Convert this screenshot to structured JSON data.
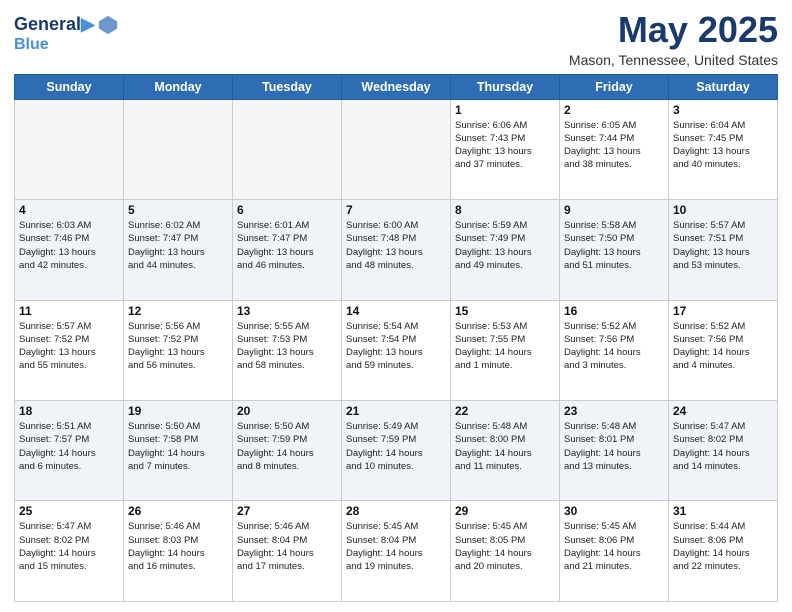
{
  "header": {
    "logo_line1": "General",
    "logo_line2": "Blue",
    "month": "May 2025",
    "location": "Mason, Tennessee, United States"
  },
  "days_of_week": [
    "Sunday",
    "Monday",
    "Tuesday",
    "Wednesday",
    "Thursday",
    "Friday",
    "Saturday"
  ],
  "weeks": [
    [
      {
        "day": "",
        "info": ""
      },
      {
        "day": "",
        "info": ""
      },
      {
        "day": "",
        "info": ""
      },
      {
        "day": "",
        "info": ""
      },
      {
        "day": "1",
        "info": "Sunrise: 6:06 AM\nSunset: 7:43 PM\nDaylight: 13 hours\nand 37 minutes."
      },
      {
        "day": "2",
        "info": "Sunrise: 6:05 AM\nSunset: 7:44 PM\nDaylight: 13 hours\nand 38 minutes."
      },
      {
        "day": "3",
        "info": "Sunrise: 6:04 AM\nSunset: 7:45 PM\nDaylight: 13 hours\nand 40 minutes."
      }
    ],
    [
      {
        "day": "4",
        "info": "Sunrise: 6:03 AM\nSunset: 7:46 PM\nDaylight: 13 hours\nand 42 minutes."
      },
      {
        "day": "5",
        "info": "Sunrise: 6:02 AM\nSunset: 7:47 PM\nDaylight: 13 hours\nand 44 minutes."
      },
      {
        "day": "6",
        "info": "Sunrise: 6:01 AM\nSunset: 7:47 PM\nDaylight: 13 hours\nand 46 minutes."
      },
      {
        "day": "7",
        "info": "Sunrise: 6:00 AM\nSunset: 7:48 PM\nDaylight: 13 hours\nand 48 minutes."
      },
      {
        "day": "8",
        "info": "Sunrise: 5:59 AM\nSunset: 7:49 PM\nDaylight: 13 hours\nand 49 minutes."
      },
      {
        "day": "9",
        "info": "Sunrise: 5:58 AM\nSunset: 7:50 PM\nDaylight: 13 hours\nand 51 minutes."
      },
      {
        "day": "10",
        "info": "Sunrise: 5:57 AM\nSunset: 7:51 PM\nDaylight: 13 hours\nand 53 minutes."
      }
    ],
    [
      {
        "day": "11",
        "info": "Sunrise: 5:57 AM\nSunset: 7:52 PM\nDaylight: 13 hours\nand 55 minutes."
      },
      {
        "day": "12",
        "info": "Sunrise: 5:56 AM\nSunset: 7:52 PM\nDaylight: 13 hours\nand 56 minutes."
      },
      {
        "day": "13",
        "info": "Sunrise: 5:55 AM\nSunset: 7:53 PM\nDaylight: 13 hours\nand 58 minutes."
      },
      {
        "day": "14",
        "info": "Sunrise: 5:54 AM\nSunset: 7:54 PM\nDaylight: 13 hours\nand 59 minutes."
      },
      {
        "day": "15",
        "info": "Sunrise: 5:53 AM\nSunset: 7:55 PM\nDaylight: 14 hours\nand 1 minute."
      },
      {
        "day": "16",
        "info": "Sunrise: 5:52 AM\nSunset: 7:56 PM\nDaylight: 14 hours\nand 3 minutes."
      },
      {
        "day": "17",
        "info": "Sunrise: 5:52 AM\nSunset: 7:56 PM\nDaylight: 14 hours\nand 4 minutes."
      }
    ],
    [
      {
        "day": "18",
        "info": "Sunrise: 5:51 AM\nSunset: 7:57 PM\nDaylight: 14 hours\nand 6 minutes."
      },
      {
        "day": "19",
        "info": "Sunrise: 5:50 AM\nSunset: 7:58 PM\nDaylight: 14 hours\nand 7 minutes."
      },
      {
        "day": "20",
        "info": "Sunrise: 5:50 AM\nSunset: 7:59 PM\nDaylight: 14 hours\nand 8 minutes."
      },
      {
        "day": "21",
        "info": "Sunrise: 5:49 AM\nSunset: 7:59 PM\nDaylight: 14 hours\nand 10 minutes."
      },
      {
        "day": "22",
        "info": "Sunrise: 5:48 AM\nSunset: 8:00 PM\nDaylight: 14 hours\nand 11 minutes."
      },
      {
        "day": "23",
        "info": "Sunrise: 5:48 AM\nSunset: 8:01 PM\nDaylight: 14 hours\nand 13 minutes."
      },
      {
        "day": "24",
        "info": "Sunrise: 5:47 AM\nSunset: 8:02 PM\nDaylight: 14 hours\nand 14 minutes."
      }
    ],
    [
      {
        "day": "25",
        "info": "Sunrise: 5:47 AM\nSunset: 8:02 PM\nDaylight: 14 hours\nand 15 minutes."
      },
      {
        "day": "26",
        "info": "Sunrise: 5:46 AM\nSunset: 8:03 PM\nDaylight: 14 hours\nand 16 minutes."
      },
      {
        "day": "27",
        "info": "Sunrise: 5:46 AM\nSunset: 8:04 PM\nDaylight: 14 hours\nand 17 minutes."
      },
      {
        "day": "28",
        "info": "Sunrise: 5:45 AM\nSunset: 8:04 PM\nDaylight: 14 hours\nand 19 minutes."
      },
      {
        "day": "29",
        "info": "Sunrise: 5:45 AM\nSunset: 8:05 PM\nDaylight: 14 hours\nand 20 minutes."
      },
      {
        "day": "30",
        "info": "Sunrise: 5:45 AM\nSunset: 8:06 PM\nDaylight: 14 hours\nand 21 minutes."
      },
      {
        "day": "31",
        "info": "Sunrise: 5:44 AM\nSunset: 8:06 PM\nDaylight: 14 hours\nand 22 minutes."
      }
    ]
  ]
}
